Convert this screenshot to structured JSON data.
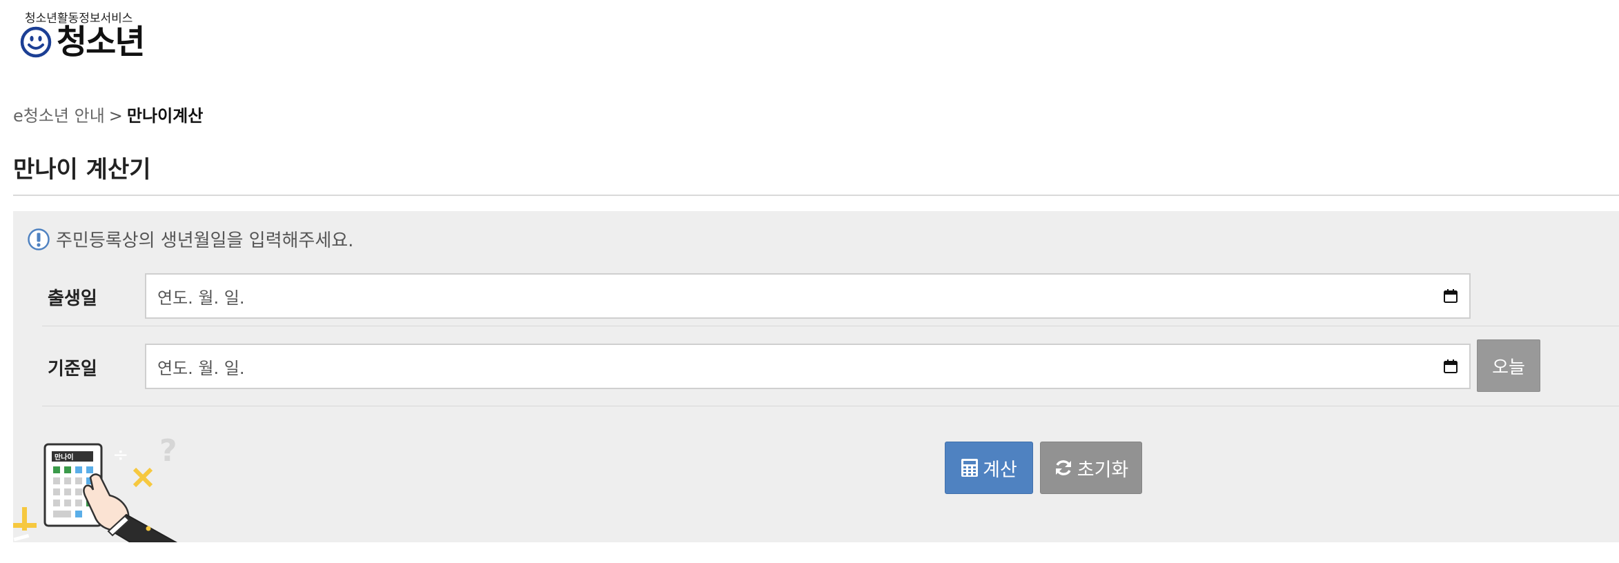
{
  "logo": {
    "subtitle": "청소년활동정보서비스",
    "name": "청소년"
  },
  "breadcrumb": {
    "parent": "e청소년 안내",
    "separator": ">",
    "current": "만나이계산"
  },
  "page": {
    "title": "만나이 계산기"
  },
  "form": {
    "notice": "주민등록상의 생년월일을 입력해주세요.",
    "birth_label": "출생일",
    "birth_placeholder": "연도. 월. 일.",
    "base_label": "기준일",
    "base_placeholder": "연도. 월. 일.",
    "today_button": "오늘",
    "calc_button": "계산",
    "reset_button": "초기화",
    "calculator_screen_text": "만나이"
  },
  "colors": {
    "primary_button": "#4f82c1",
    "secondary_button": "#929292",
    "logo_blue": "#1c3f94",
    "panel_bg": "#eeeeee"
  },
  "icons": {
    "notice": "exclamation-circle-icon",
    "calendar": "calendar-icon",
    "calc": "calculator-icon",
    "reset": "refresh-icon"
  }
}
